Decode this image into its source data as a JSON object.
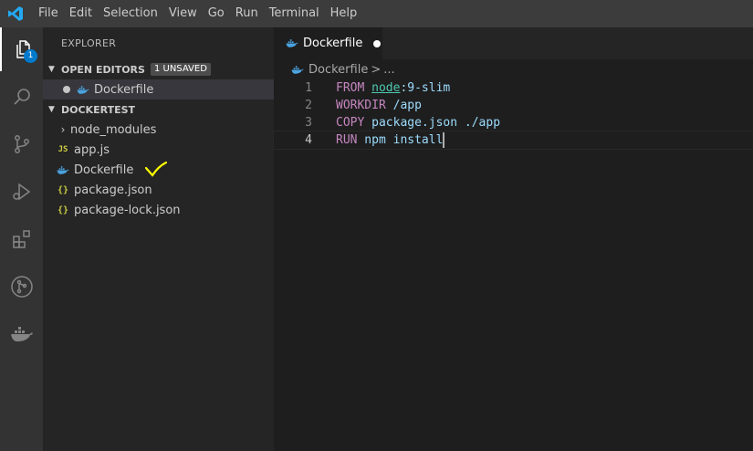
{
  "menu": [
    "File",
    "Edit",
    "Selection",
    "View",
    "Go",
    "Run",
    "Terminal",
    "Help"
  ],
  "activity_bar": {
    "explorer_badge": "1",
    "items": [
      "explorer-icon",
      "search-icon",
      "source-control-icon",
      "run-debug-icon",
      "extensions-icon",
      "git-graph-icon",
      "docker-icon"
    ]
  },
  "sidebar": {
    "title": "EXPLORER",
    "open_editors": {
      "header": "OPEN EDITORS",
      "badge": "1 UNSAVED",
      "items": [
        {
          "label": "Dockerfile",
          "icon": "docker-icon",
          "unsaved": true
        }
      ]
    },
    "workspace": {
      "header": "DOCKERTEST",
      "items": [
        {
          "label": "node_modules",
          "icon": "chevron-right-icon"
        },
        {
          "label": "app.js",
          "icon": "js-icon",
          "icon_text": "JS"
        },
        {
          "label": "Dockerfile",
          "icon": "docker-icon"
        },
        {
          "label": "package.json",
          "icon": "json-icon",
          "icon_text": "{}"
        },
        {
          "label": "package-lock.json",
          "icon": "json-icon",
          "icon_text": "{}"
        }
      ]
    }
  },
  "editor": {
    "tab": {
      "label": "Dockerfile",
      "dirty": true
    },
    "breadcrumb": {
      "file": "Dockerfile",
      "separator": ">",
      "more": "..."
    },
    "lines": [
      {
        "number": "1",
        "keyword": "FROM",
        "image": "node",
        "rest": ":9-slim"
      },
      {
        "number": "2",
        "keyword": "WORKDIR",
        "rest": " /app"
      },
      {
        "number": "3",
        "keyword": "COPY",
        "rest": " package.json ./app"
      },
      {
        "number": "4",
        "keyword": "RUN",
        "rest": " npm install"
      }
    ]
  },
  "colors": {
    "accent": "#007acc",
    "keyword": "#c586c0",
    "highlight": "#4ec9b0",
    "value": "#9cdcfe",
    "annotation": "#ffff00"
  }
}
